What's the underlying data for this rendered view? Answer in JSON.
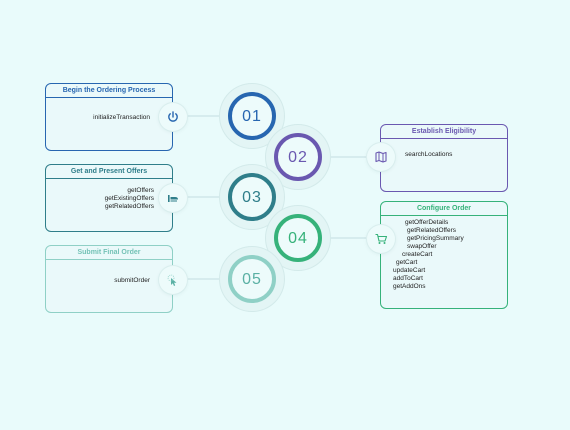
{
  "steps": [
    {
      "number": "01",
      "title": "Begin the Ordering Process",
      "icon": "power-icon",
      "color": "#2766b0",
      "items": [
        "initializeTransaction"
      ]
    },
    {
      "number": "02",
      "title": "Establish Eligibility",
      "icon": "map-icon",
      "color": "#6a58b0",
      "items": [
        "searchLocations"
      ]
    },
    {
      "number": "03",
      "title": "Get and Present Offers",
      "icon": "offers-icon",
      "color": "#2f7e8a",
      "items": [
        "getOffers",
        "getExistingOffers",
        "getRelatedOffers"
      ]
    },
    {
      "number": "04",
      "title": "Configure Order",
      "icon": "cart-icon",
      "color": "#36b27a",
      "items": [
        "getOfferDetails",
        "getRelatedOffers",
        "getPricingSummary",
        "swapOffer",
        "createCart",
        "getCart",
        "updateCart",
        "addToCart",
        "getAddOns"
      ]
    },
    {
      "number": "05",
      "title": "Submit Final Order",
      "icon": "pointer-icon",
      "color": "#8fd0c6",
      "items": [
        "submitOrder"
      ]
    }
  ]
}
